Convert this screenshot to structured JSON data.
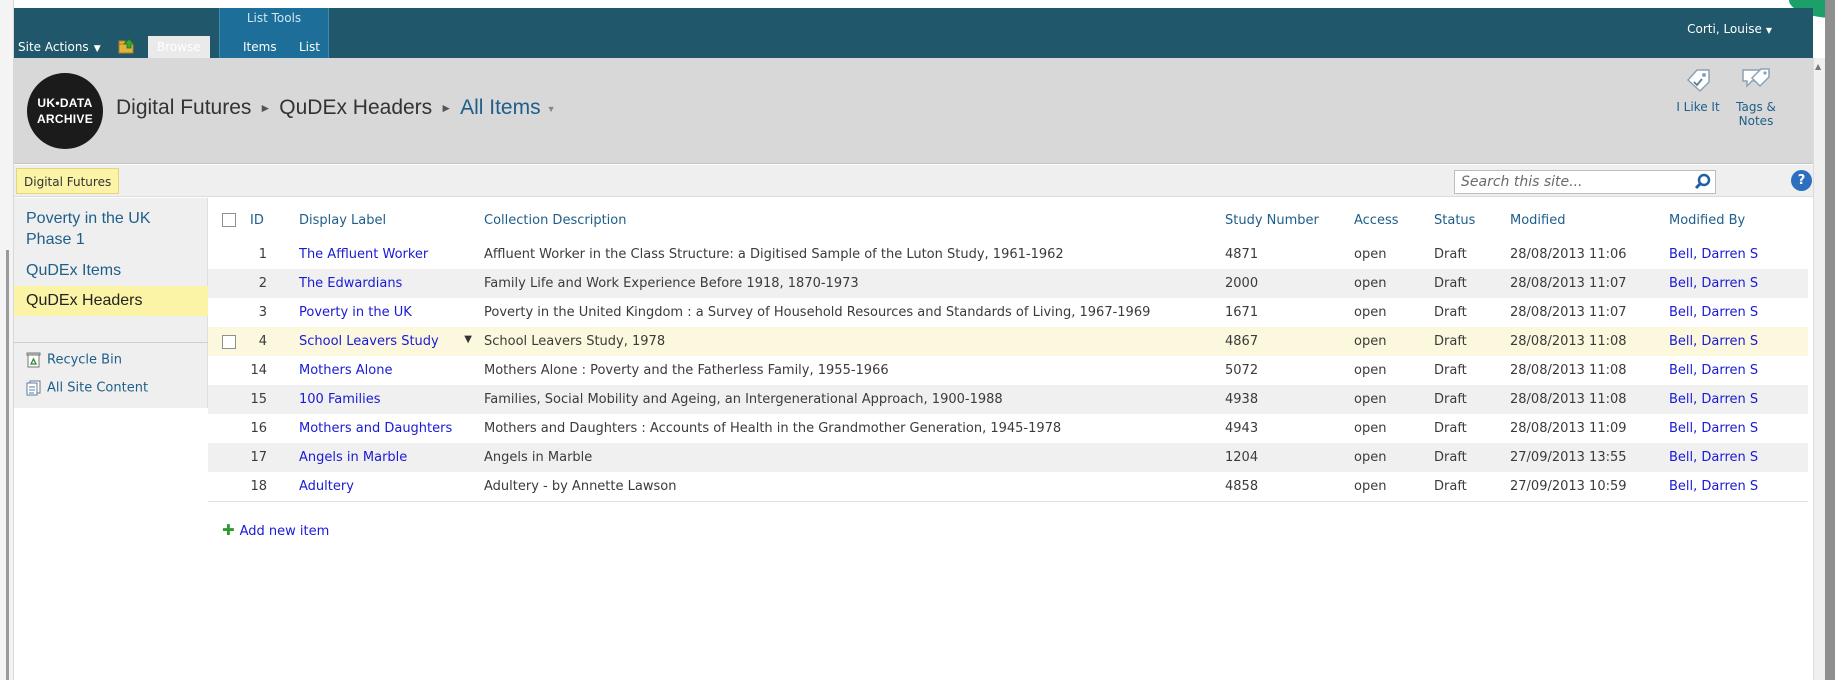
{
  "ribbon": {
    "site_actions": "Site Actions",
    "list_tools": "List Tools",
    "tabs": {
      "browse": "Browse",
      "items": "Items",
      "list": "List"
    },
    "user": "Corti, Louise"
  },
  "header": {
    "logo_line1": "UK•DATA",
    "logo_line2": "ARCHIVE",
    "breadcrumb": [
      "Digital Futures",
      "QuDEx Headers",
      "All Items"
    ],
    "i_like_it": "I Like It",
    "tags_notes": "Tags & Notes"
  },
  "topbar": {
    "home": "Digital Futures",
    "search_placeholder": "Search this site...",
    "help": "?"
  },
  "left_nav": {
    "items": [
      "Poverty in the UK Phase 1",
      "QuDEx Items",
      "QuDEx Headers"
    ],
    "recycle_bin": "Recycle Bin",
    "all_site_content": "All Site Content"
  },
  "list": {
    "columns": [
      "ID",
      "Display Label",
      "Collection Description",
      "Study Number",
      "Access",
      "Status",
      "Modified",
      "Modified By"
    ],
    "rows": [
      {
        "id": "1",
        "label": "The Affluent Worker",
        "desc": "Affluent Worker in the Class Structure: a Digitised Sample of the Luton Study, 1961-1962",
        "study": "4871",
        "access": "open",
        "status": "Draft",
        "modified": "28/08/2013 11:06",
        "by": "Bell, Darren S"
      },
      {
        "id": "2",
        "label": "The Edwardians",
        "desc": "Family Life and Work Experience Before 1918, 1870-1973",
        "study": "2000",
        "access": "open",
        "status": "Draft",
        "modified": "28/08/2013 11:07",
        "by": "Bell, Darren S"
      },
      {
        "id": "3",
        "label": "Poverty in the UK",
        "desc": "Poverty in the United Kingdom : a Survey of Household Resources and Standards of Living, 1967-1969",
        "study": "1671",
        "access": "open",
        "status": "Draft",
        "modified": "28/08/2013 11:07",
        "by": "Bell, Darren S"
      },
      {
        "id": "4",
        "label": "School Leavers Study",
        "desc": "School Leavers Study, 1978",
        "study": "4867",
        "access": "open",
        "status": "Draft",
        "modified": "28/08/2013 11:08",
        "by": "Bell, Darren S"
      },
      {
        "id": "14",
        "label": "Mothers Alone",
        "desc": "Mothers Alone : Poverty and the Fatherless Family, 1955-1966",
        "study": "5072",
        "access": "open",
        "status": "Draft",
        "modified": "28/08/2013 11:08",
        "by": "Bell, Darren S"
      },
      {
        "id": "15",
        "label": "100 Families",
        "desc": "Families, Social Mobility and Ageing, an Intergenerational Approach, 1900-1988",
        "study": "4938",
        "access": "open",
        "status": "Draft",
        "modified": "28/08/2013 11:08",
        "by": "Bell, Darren S"
      },
      {
        "id": "16",
        "label": "Mothers and Daughters",
        "desc": "Mothers and Daughters : Accounts of Health in the Grandmother Generation, 1945-1978",
        "study": "4943",
        "access": "open",
        "status": "Draft",
        "modified": "28/08/2013 11:09",
        "by": "Bell, Darren S"
      },
      {
        "id": "17",
        "label": "Angels in Marble",
        "desc": "Angels in Marble",
        "study": "1204",
        "access": "open",
        "status": "Draft",
        "modified": "27/09/2013 13:55",
        "by": "Bell, Darren S"
      },
      {
        "id": "18",
        "label": "Adultery",
        "desc": "Adultery - by Annette Lawson",
        "study": "4858",
        "access": "open",
        "status": "Draft",
        "modified": "27/09/2013 10:59",
        "by": "Bell, Darren S"
      }
    ],
    "add_new": "Add new item"
  }
}
